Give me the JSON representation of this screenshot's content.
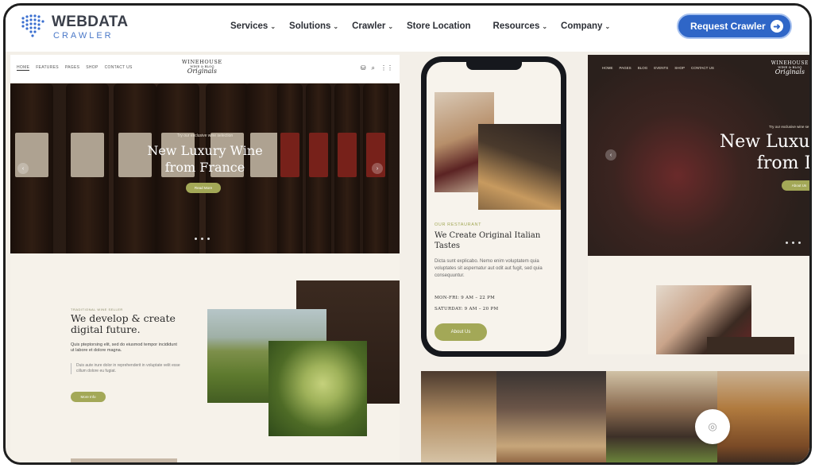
{
  "brand": {
    "main": "WEBDATA",
    "sub": "CRAWLER"
  },
  "nav": [
    {
      "label": "Services",
      "dropdown": true
    },
    {
      "label": "Solutions",
      "dropdown": true
    },
    {
      "label": "Crawler",
      "dropdown": true
    },
    {
      "label": "Store Location",
      "dropdown": false
    },
    {
      "label": "Resources",
      "dropdown": true
    },
    {
      "label": "Company",
      "dropdown": true
    }
  ],
  "cta": {
    "label": "Request Crawler",
    "icon": "arrow-right-icon"
  },
  "left_site": {
    "nav_links": [
      "HOME",
      "FEATURES",
      "PAGES",
      "SHOP",
      "CONTACT US"
    ],
    "logo": {
      "line1": "WINEHOUSE",
      "line2": "WINE & BLOG",
      "line3": "Originals"
    },
    "hero": {
      "kicker": "Try our exclusive wine selection",
      "title_line1": "New Luxury Wine",
      "title_line2": "from France",
      "button": "Read More"
    },
    "about": {
      "kicker": "TRADITIONAL WINE SELLER",
      "title": "We develop & create digital future.",
      "text": "Quis pteptorsing elit, sed do eiusmod tempor incididunt ut labore et dolore magna.",
      "quote": "Duis aute irure dolor in reprehenderit in voluptate velit esse cillum dolore eu fugiat.",
      "button": "More Info"
    }
  },
  "phone": {
    "kicker": "OUR RESTAURANT",
    "title": "We Create Original Italian Tastes",
    "text": "Dicta sunt explicabo. Nemo enim voluptatem quia voluptates sit aspernatur aut odit aut fugit, sed quia consequuntur.",
    "hours1": "MON-FRI: 9 AM – 22 PM",
    "hours2": "SATURDAY: 9 AM – 20 PM",
    "button": "About Us"
  },
  "right_site": {
    "nav_links": [
      "HOME",
      "PAGES",
      "BLOG",
      "EVENTS",
      "SHOP",
      "CONTACT US"
    ],
    "logo": {
      "line1": "WINEHOUSE",
      "line2": "WINE & BLOG",
      "line3": "Originals"
    },
    "hero": {
      "kicker": "Try our exclusive wine se",
      "title_line1": "New Luxur",
      "title_line2": "from It",
      "button": "About Us"
    }
  },
  "gallery_icon": "instagram-icon",
  "colors": {
    "brand_blue": "#2f66c7",
    "olive": "#a3a857"
  }
}
